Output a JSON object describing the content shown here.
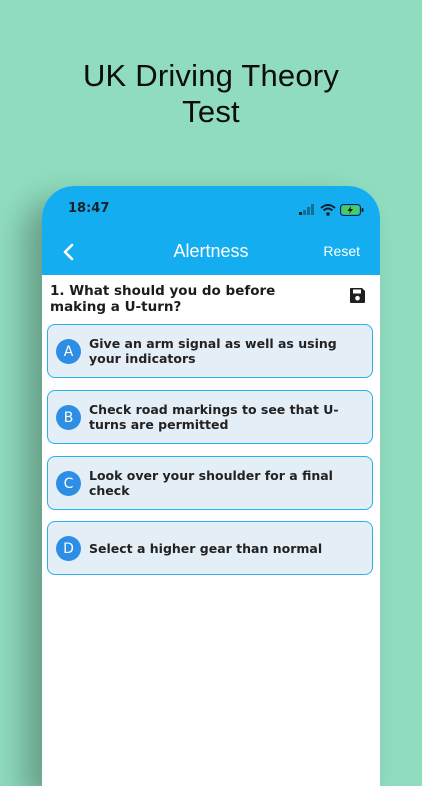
{
  "promo": {
    "title_line1": "UK Driving Theory",
    "title_line2": "Test"
  },
  "status_bar": {
    "time": "18:47"
  },
  "header": {
    "title": "Alertness",
    "reset_label": "Reset",
    "back_icon": "chevron-left-icon"
  },
  "question": {
    "text": "1. What should you do before making a U-turn?",
    "save_icon": "floppy-disk-icon"
  },
  "options": [
    {
      "letter": "A",
      "text": "Give an arm signal as well as using your indicators"
    },
    {
      "letter": "B",
      "text": "Check road markings to see that U-turns are permitted"
    },
    {
      "letter": "C",
      "text": "Look over your shoulder for a final check"
    },
    {
      "letter": "D",
      "text": "Select a higher gear than normal"
    }
  ],
  "colors": {
    "background": "#8fdcbe",
    "header": "#14aef0",
    "option_fill": "#e4eef6",
    "option_border": "#2ab0ee",
    "letter_badge": "#2d8ee6"
  }
}
